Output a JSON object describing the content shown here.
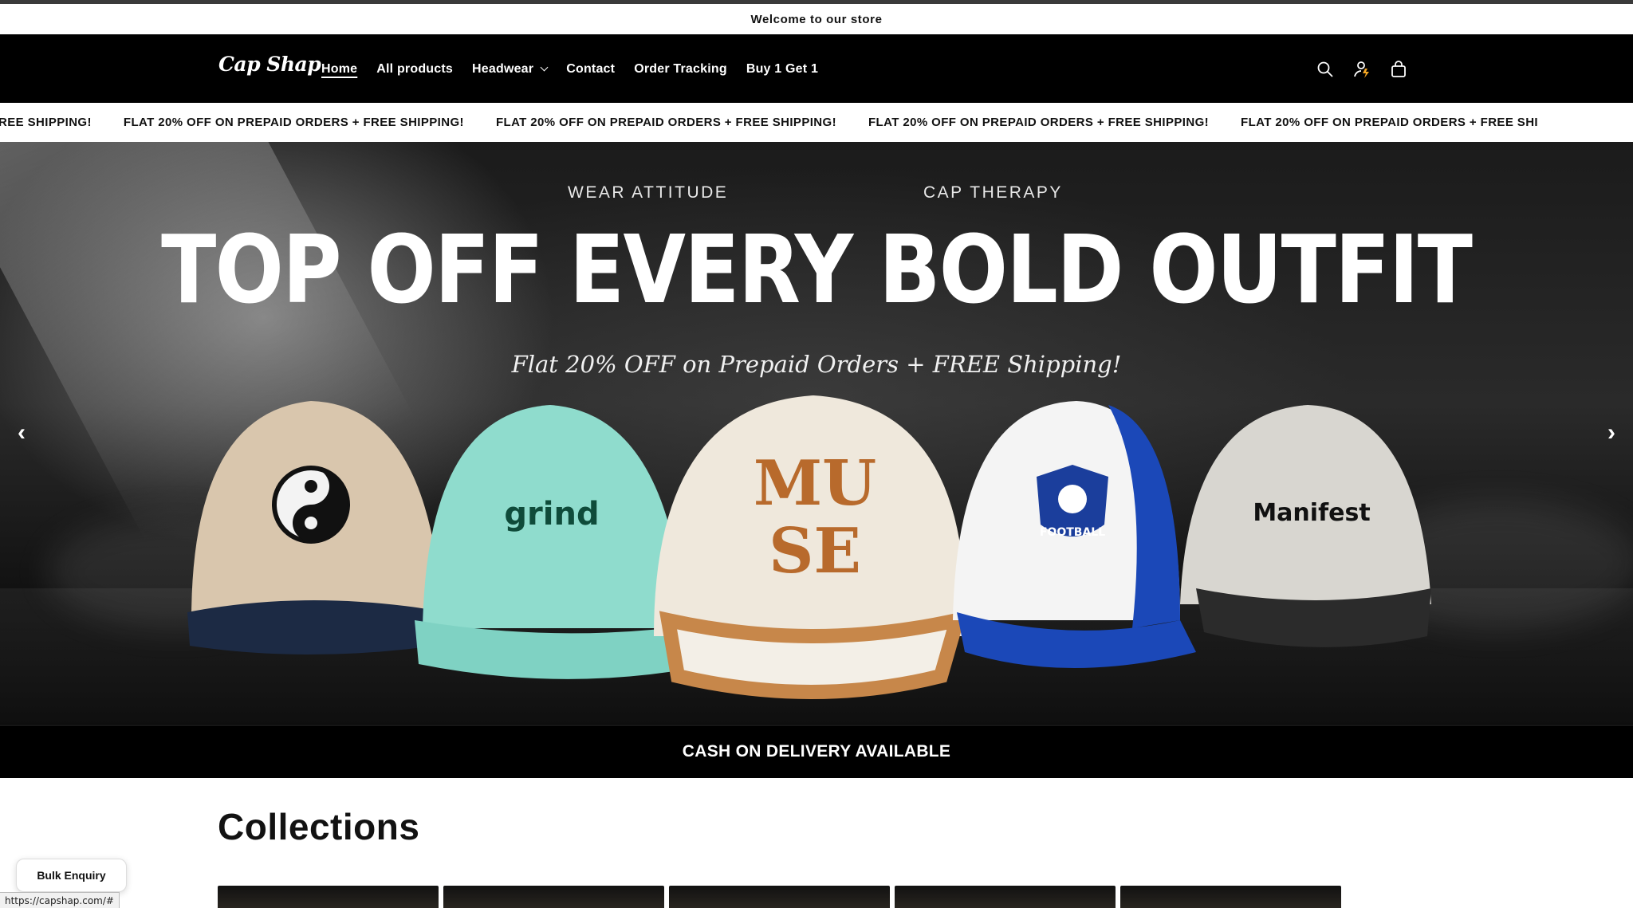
{
  "announcement": {
    "text": "Welcome to our store"
  },
  "header": {
    "logo": "Cap Shap",
    "nav": [
      {
        "label": "Home",
        "active": true
      },
      {
        "label": "All products"
      },
      {
        "label": "Headwear",
        "has_dropdown": true
      },
      {
        "label": "Contact"
      },
      {
        "label": "Order Tracking"
      },
      {
        "label": "Buy 1 Get 1"
      }
    ],
    "icons": [
      "search-icon",
      "account-icon",
      "cart-icon"
    ]
  },
  "marquee": {
    "items": [
      "REE SHIPPING!",
      "FLAT 20% OFF ON PREPAID ORDERS + FREE SHIPPING!",
      "FLAT 20% OFF ON PREPAID ORDERS + FREE SHIPPING!",
      "FLAT 20% OFF ON PREPAID ORDERS + FREE SHIPPING!",
      "FLAT 20% OFF ON PREPAID ORDERS + FREE SHI"
    ]
  },
  "hero": {
    "sub_left": "WEAR  ATTITUDE",
    "sub_right": "CAP THERAPY",
    "title": "TOP OFF EVERY BOLD OUTFIT",
    "tagline": "Flat 20% OFF on Prepaid Orders + FREE Shipping!",
    "prev_arrow": "‹",
    "next_arrow": "›",
    "caps": [
      {
        "label": "",
        "crown": "#d9c6ad",
        "brim": "#1c2a44",
        "logo_color": "#111"
      },
      {
        "label": "grind",
        "crown": "#8fdccd",
        "brim": "#7fd2c3",
        "logo_color": "#0f4b3a"
      },
      {
        "label": "MU SE",
        "crown": "#efe8dc",
        "brim": "#c7874a",
        "logo_color": "#b86a2c"
      },
      {
        "label": "FOOTBALL",
        "crown": "#f4f4f4",
        "brim": "#1b48b8",
        "logo_color": "#1b3e9c"
      },
      {
        "label": "Manifest",
        "crown": "#d8d6d0",
        "brim": "#2b2b2b",
        "logo_color": "#111"
      }
    ]
  },
  "cod_banner": {
    "text": "CASH ON DELIVERY AVAILABLE"
  },
  "collections": {
    "title": "Collections",
    "tile_count": 5
  },
  "bulk_enquiry": {
    "label": "Bulk Enquiry"
  },
  "status_bar": {
    "url": "https://capshap.com/#"
  }
}
